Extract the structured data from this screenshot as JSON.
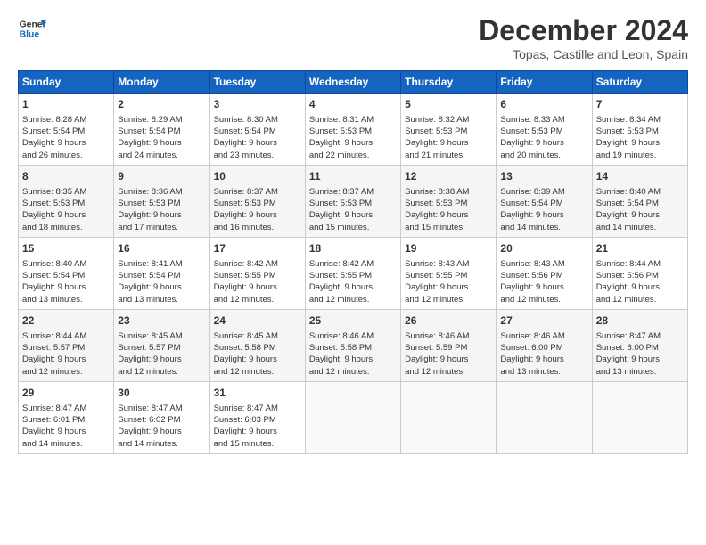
{
  "header": {
    "logo_line1": "General",
    "logo_line2": "Blue",
    "title": "December 2024",
    "subtitle": "Topas, Castille and Leon, Spain"
  },
  "days_of_week": [
    "Sunday",
    "Monday",
    "Tuesday",
    "Wednesday",
    "Thursday",
    "Friday",
    "Saturday"
  ],
  "weeks": [
    [
      {
        "day": "1",
        "lines": [
          "Sunrise: 8:28 AM",
          "Sunset: 5:54 PM",
          "Daylight: 9 hours",
          "and 26 minutes."
        ]
      },
      {
        "day": "2",
        "lines": [
          "Sunrise: 8:29 AM",
          "Sunset: 5:54 PM",
          "Daylight: 9 hours",
          "and 24 minutes."
        ]
      },
      {
        "day": "3",
        "lines": [
          "Sunrise: 8:30 AM",
          "Sunset: 5:54 PM",
          "Daylight: 9 hours",
          "and 23 minutes."
        ]
      },
      {
        "day": "4",
        "lines": [
          "Sunrise: 8:31 AM",
          "Sunset: 5:53 PM",
          "Daylight: 9 hours",
          "and 22 minutes."
        ]
      },
      {
        "day": "5",
        "lines": [
          "Sunrise: 8:32 AM",
          "Sunset: 5:53 PM",
          "Daylight: 9 hours",
          "and 21 minutes."
        ]
      },
      {
        "day": "6",
        "lines": [
          "Sunrise: 8:33 AM",
          "Sunset: 5:53 PM",
          "Daylight: 9 hours",
          "and 20 minutes."
        ]
      },
      {
        "day": "7",
        "lines": [
          "Sunrise: 8:34 AM",
          "Sunset: 5:53 PM",
          "Daylight: 9 hours",
          "and 19 minutes."
        ]
      }
    ],
    [
      {
        "day": "8",
        "lines": [
          "Sunrise: 8:35 AM",
          "Sunset: 5:53 PM",
          "Daylight: 9 hours",
          "and 18 minutes."
        ]
      },
      {
        "day": "9",
        "lines": [
          "Sunrise: 8:36 AM",
          "Sunset: 5:53 PM",
          "Daylight: 9 hours",
          "and 17 minutes."
        ]
      },
      {
        "day": "10",
        "lines": [
          "Sunrise: 8:37 AM",
          "Sunset: 5:53 PM",
          "Daylight: 9 hours",
          "and 16 minutes."
        ]
      },
      {
        "day": "11",
        "lines": [
          "Sunrise: 8:37 AM",
          "Sunset: 5:53 PM",
          "Daylight: 9 hours",
          "and 15 minutes."
        ]
      },
      {
        "day": "12",
        "lines": [
          "Sunrise: 8:38 AM",
          "Sunset: 5:53 PM",
          "Daylight: 9 hours",
          "and 15 minutes."
        ]
      },
      {
        "day": "13",
        "lines": [
          "Sunrise: 8:39 AM",
          "Sunset: 5:54 PM",
          "Daylight: 9 hours",
          "and 14 minutes."
        ]
      },
      {
        "day": "14",
        "lines": [
          "Sunrise: 8:40 AM",
          "Sunset: 5:54 PM",
          "Daylight: 9 hours",
          "and 14 minutes."
        ]
      }
    ],
    [
      {
        "day": "15",
        "lines": [
          "Sunrise: 8:40 AM",
          "Sunset: 5:54 PM",
          "Daylight: 9 hours",
          "and 13 minutes."
        ]
      },
      {
        "day": "16",
        "lines": [
          "Sunrise: 8:41 AM",
          "Sunset: 5:54 PM",
          "Daylight: 9 hours",
          "and 13 minutes."
        ]
      },
      {
        "day": "17",
        "lines": [
          "Sunrise: 8:42 AM",
          "Sunset: 5:55 PM",
          "Daylight: 9 hours",
          "and 12 minutes."
        ]
      },
      {
        "day": "18",
        "lines": [
          "Sunrise: 8:42 AM",
          "Sunset: 5:55 PM",
          "Daylight: 9 hours",
          "and 12 minutes."
        ]
      },
      {
        "day": "19",
        "lines": [
          "Sunrise: 8:43 AM",
          "Sunset: 5:55 PM",
          "Daylight: 9 hours",
          "and 12 minutes."
        ]
      },
      {
        "day": "20",
        "lines": [
          "Sunrise: 8:43 AM",
          "Sunset: 5:56 PM",
          "Daylight: 9 hours",
          "and 12 minutes."
        ]
      },
      {
        "day": "21",
        "lines": [
          "Sunrise: 8:44 AM",
          "Sunset: 5:56 PM",
          "Daylight: 9 hours",
          "and 12 minutes."
        ]
      }
    ],
    [
      {
        "day": "22",
        "lines": [
          "Sunrise: 8:44 AM",
          "Sunset: 5:57 PM",
          "Daylight: 9 hours",
          "and 12 minutes."
        ]
      },
      {
        "day": "23",
        "lines": [
          "Sunrise: 8:45 AM",
          "Sunset: 5:57 PM",
          "Daylight: 9 hours",
          "and 12 minutes."
        ]
      },
      {
        "day": "24",
        "lines": [
          "Sunrise: 8:45 AM",
          "Sunset: 5:58 PM",
          "Daylight: 9 hours",
          "and 12 minutes."
        ]
      },
      {
        "day": "25",
        "lines": [
          "Sunrise: 8:46 AM",
          "Sunset: 5:58 PM",
          "Daylight: 9 hours",
          "and 12 minutes."
        ]
      },
      {
        "day": "26",
        "lines": [
          "Sunrise: 8:46 AM",
          "Sunset: 5:59 PM",
          "Daylight: 9 hours",
          "and 12 minutes."
        ]
      },
      {
        "day": "27",
        "lines": [
          "Sunrise: 8:46 AM",
          "Sunset: 6:00 PM",
          "Daylight: 9 hours",
          "and 13 minutes."
        ]
      },
      {
        "day": "28",
        "lines": [
          "Sunrise: 8:47 AM",
          "Sunset: 6:00 PM",
          "Daylight: 9 hours",
          "and 13 minutes."
        ]
      }
    ],
    [
      {
        "day": "29",
        "lines": [
          "Sunrise: 8:47 AM",
          "Sunset: 6:01 PM",
          "Daylight: 9 hours",
          "and 14 minutes."
        ]
      },
      {
        "day": "30",
        "lines": [
          "Sunrise: 8:47 AM",
          "Sunset: 6:02 PM",
          "Daylight: 9 hours",
          "and 14 minutes."
        ]
      },
      {
        "day": "31",
        "lines": [
          "Sunrise: 8:47 AM",
          "Sunset: 6:03 PM",
          "Daylight: 9 hours",
          "and 15 minutes."
        ]
      },
      null,
      null,
      null,
      null
    ]
  ]
}
